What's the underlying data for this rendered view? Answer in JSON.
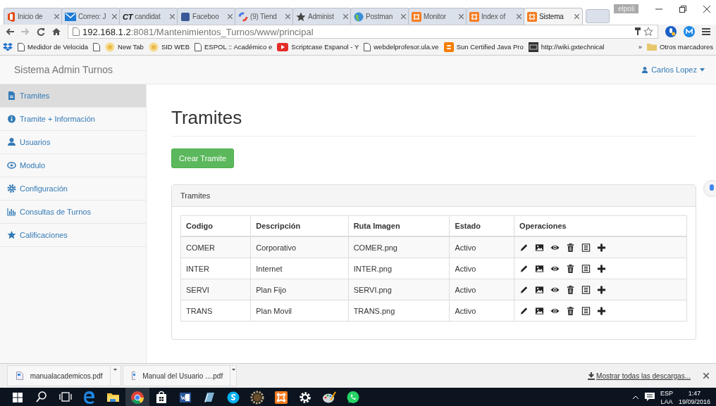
{
  "browser": {
    "tabs": [
      {
        "label": "Inicio de",
        "kind": "office",
        "selected": false
      },
      {
        "label": "Correo: J",
        "kind": "mail",
        "selected": false
      },
      {
        "label": "candidat",
        "kind": "ct",
        "logo": "CT",
        "selected": false
      },
      {
        "label": "Faceboo",
        "kind": "facebook",
        "selected": false
      },
      {
        "label": "(9) Tiend",
        "kind": "ring",
        "selected": false
      },
      {
        "label": "Administ",
        "kind": "star",
        "selected": false
      },
      {
        "label": "Postman",
        "kind": "globe",
        "selected": false
      },
      {
        "label": "Monitor",
        "kind": "xampp",
        "selected": false
      },
      {
        "label": "Index of",
        "kind": "xampp",
        "selected": false
      },
      {
        "label": "Sistema",
        "kind": "xampp",
        "selected": true
      }
    ],
    "profile": "elpoli",
    "address": {
      "host": "192.168.1.2",
      "rest": ":8081/Mantenimientos_Turnos/www/principal"
    },
    "bookmarks": [
      {
        "label": "Medidor de Velocida",
        "kind": "page"
      },
      {
        "kind": "page"
      },
      {
        "label": "New Tab",
        "kind": "sun"
      },
      {
        "label": "SID WEB",
        "kind": "sun"
      },
      {
        "label": "ESPOL :: Académico e",
        "kind": "page"
      },
      {
        "label": "Scriptcase Espanol - Y",
        "kind": "youtube"
      },
      {
        "label": "webdelprofesor.ula.ve",
        "kind": "page"
      },
      {
        "label": "Sun Certified Java Pro",
        "kind": "blogger"
      },
      {
        "label": "http://wiki.gxtechnical",
        "kind": "gx"
      }
    ],
    "more": "»",
    "other_bookmarks": "Otros marcadores"
  },
  "app": {
    "brand": "Sistema Admin Turnos",
    "user": "Carlos Lopez",
    "sidebar": [
      {
        "label": "Tramites",
        "kind": "file",
        "selected": true
      },
      {
        "label": "Tramite + Información",
        "kind": "info",
        "selected": false
      },
      {
        "label": "Usuarios",
        "kind": "user",
        "selected": false
      },
      {
        "label": "Modulo",
        "kind": "module",
        "selected": false
      },
      {
        "label": "Configuración",
        "kind": "gear",
        "selected": false
      },
      {
        "label": "Consultas de Turnos",
        "kind": "chart",
        "selected": false
      },
      {
        "label": "Calificaciones",
        "kind": "star",
        "selected": false
      }
    ],
    "title": "Tramites",
    "create_button": "Crear Tramite",
    "panel": {
      "heading": "Tramites",
      "columns": [
        "Codigo",
        "Descripción",
        "Ruta Imagen",
        "Estado",
        "Operaciones"
      ],
      "rows": [
        [
          "COMER",
          "Corporativo",
          "COMER.png",
          "Activo"
        ],
        [
          "INTER",
          "Internet",
          "INTER.png",
          "Activo"
        ],
        [
          "SERVI",
          "Plan Fijo",
          "SERVI.png",
          "Activo"
        ],
        [
          "TRANS",
          "Plan Movil",
          "TRANS.png",
          "Activo"
        ]
      ]
    }
  },
  "downloads": {
    "items": [
      "manualacademicos.pdf",
      "Manual del Usuario ....pdf"
    ],
    "show_all": "Mostrar todas las descargas..."
  },
  "taskbar": {
    "apps": [
      {
        "kind": "search",
        "selected": false
      },
      {
        "kind": "taskview",
        "selected": false
      },
      {
        "kind": "edge",
        "selected": false
      },
      {
        "kind": "explorer",
        "selected": false
      },
      {
        "kind": "chrome",
        "selected": true
      },
      {
        "kind": "store",
        "selected": false
      },
      {
        "kind": "word",
        "selected": false
      },
      {
        "kind": "notes",
        "selected": false
      },
      {
        "kind": "skype",
        "selected": false
      },
      {
        "kind": "cog-app",
        "selected": false
      },
      {
        "kind": "xampp",
        "selected": false
      },
      {
        "kind": "settings",
        "selected": false
      },
      {
        "kind": "paint",
        "selected": false
      },
      {
        "kind": "whatsapp",
        "selected": false
      }
    ],
    "language": "ESP",
    "layout": "LAA",
    "time": "1:47",
    "date": "19/09/2016"
  }
}
